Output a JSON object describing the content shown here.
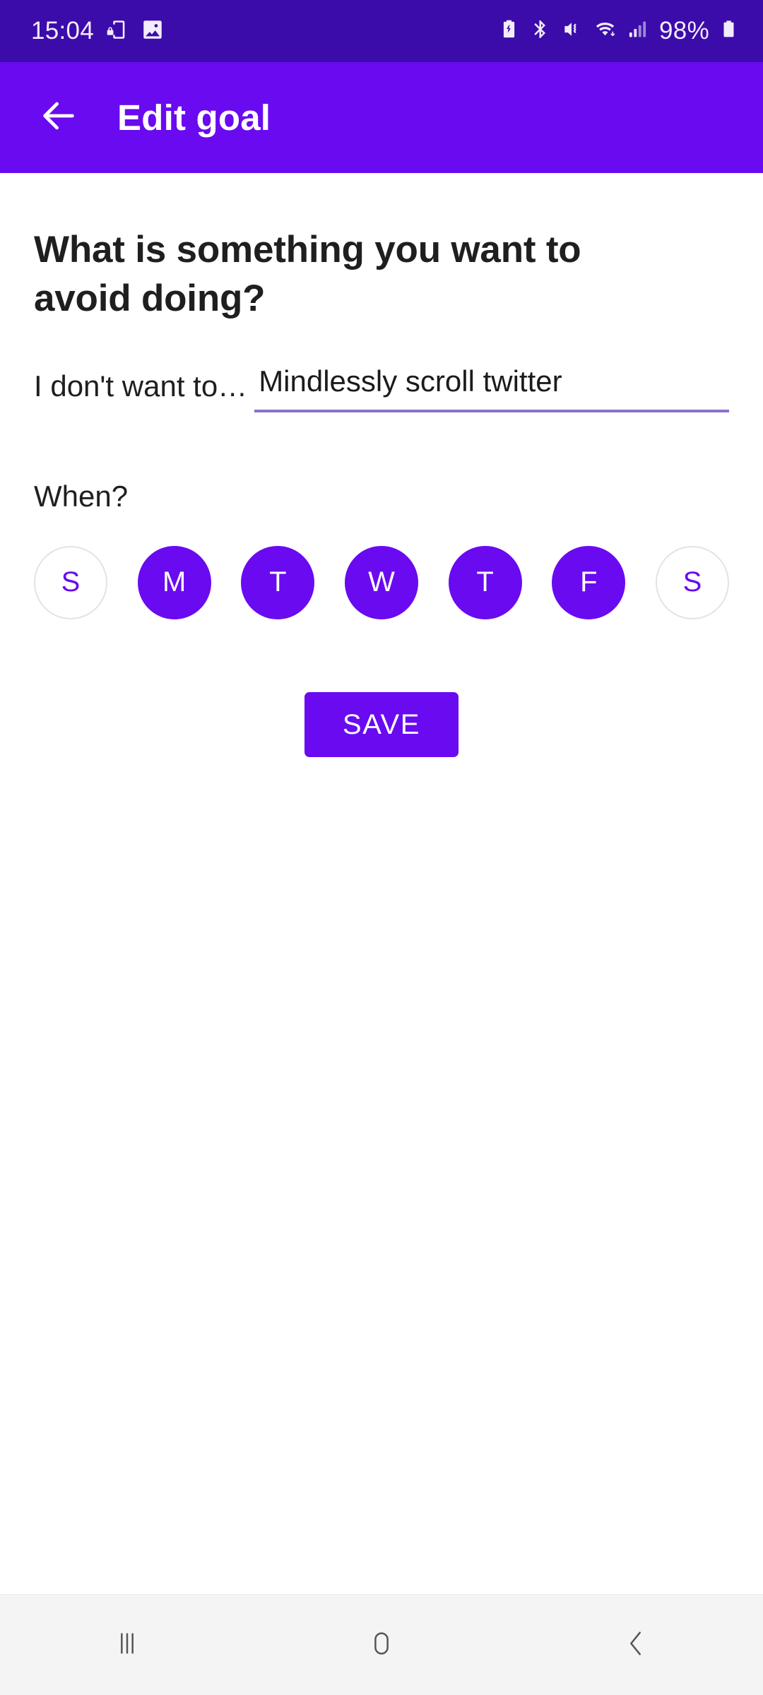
{
  "status_bar": {
    "time": "15:04",
    "battery_percent": "98%",
    "background_color": "#3B0CA9",
    "left_icons": [
      "screen-lock-rotation-icon",
      "gallery-image-icon"
    ],
    "right_icons": [
      "battery-saver-icon",
      "bluetooth-icon",
      "mute-vibrate-icon",
      "wifi-icon",
      "cellular-signal-icon",
      "battery-icon"
    ]
  },
  "app_bar": {
    "title": "Edit goal",
    "back_icon": "arrow-left-icon",
    "background_color": "#6A0AF0",
    "text_color": "#FFFFFF"
  },
  "main": {
    "question": "What is something you want to avoid doing?",
    "goal_field": {
      "label": "I don't want to…",
      "value": "Mindlessly scroll twitter",
      "placeholder": "Mindlessly scroll twitter",
      "underline_color": "#8D70C6"
    },
    "when_label": "When?",
    "days": [
      {
        "letter": "S",
        "name": "sunday",
        "selected": false
      },
      {
        "letter": "M",
        "name": "monday",
        "selected": true
      },
      {
        "letter": "T",
        "name": "tuesday",
        "selected": true
      },
      {
        "letter": "W",
        "name": "wednesday",
        "selected": true
      },
      {
        "letter": "T",
        "name": "thursday",
        "selected": true
      },
      {
        "letter": "F",
        "name": "friday",
        "selected": true
      },
      {
        "letter": "S",
        "name": "saturday",
        "selected": false
      }
    ],
    "save_label": "SAVE",
    "accent_color": "#6A0AF0"
  },
  "nav_bar": {
    "recents_icon": "recents-icon",
    "home_icon": "home-icon",
    "back_icon": "back-chevron-icon",
    "background_color": "#F4F4F4"
  }
}
